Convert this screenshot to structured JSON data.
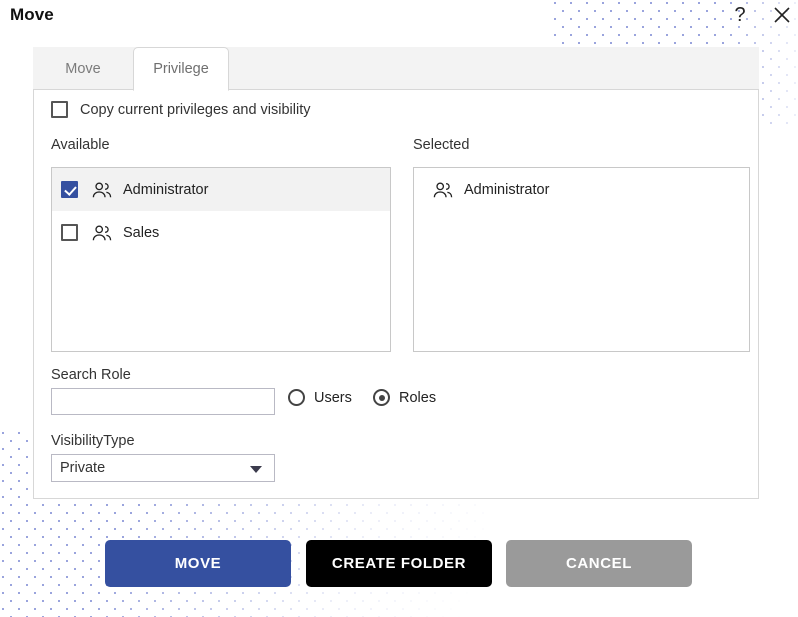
{
  "header": {
    "title": "Move",
    "help_icon": "question-mark-icon",
    "close_icon": "close-icon"
  },
  "tabs": [
    {
      "label": "Move",
      "active": false
    },
    {
      "label": "Privilege",
      "active": true
    }
  ],
  "form": {
    "copy_privileges": {
      "label": "Copy current privileges and visibility",
      "checked": false
    },
    "available": {
      "label": "Available",
      "items": [
        {
          "label": "Administrator",
          "checked": true,
          "highlighted": true,
          "icon": "group-icon"
        },
        {
          "label": "Sales",
          "checked": false,
          "highlighted": false,
          "icon": "group-icon"
        }
      ]
    },
    "selected": {
      "label": "Selected",
      "items": [
        {
          "label": "Administrator",
          "icon": "group-icon"
        }
      ]
    },
    "search_role": {
      "label": "Search Role",
      "value": "",
      "placeholder": ""
    },
    "scope_radios": [
      {
        "label": "Users",
        "selected": false
      },
      {
        "label": "Roles",
        "selected": true
      }
    ],
    "visibility": {
      "label": "VisibilityType",
      "value": "Private",
      "caret": "chevron-down-icon"
    }
  },
  "footer": {
    "move_label": "MOVE",
    "create_folder_label": "CREATE FOLDER",
    "cancel_label": "CANCEL"
  },
  "colors": {
    "accent_blue": "#3550a0",
    "black": "#000000",
    "gray": "#9a9a9a",
    "dot_pattern": "#9aa4dd"
  }
}
